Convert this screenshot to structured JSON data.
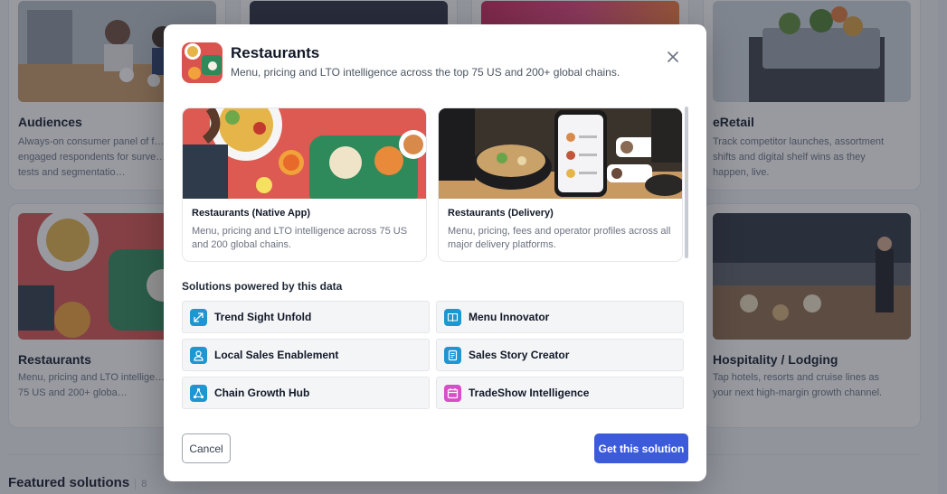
{
  "background": {
    "cards": [
      {
        "title": "Audiences",
        "description": "Always-on consumer panel of f… engaged respondents for surve… concept tests and segmentatio…"
      },
      {
        "title": "eRetail",
        "description": "Track competitor launches, assortment shifts and digital shelf wins as they happen, live."
      },
      {
        "title": "Restaurants",
        "description": "Menu, pricing and LTO intellige… the top 75 US and 200+ globa…"
      },
      {
        "title": "Hospitality / Lodging",
        "description": "Tap hotels, resorts and cruise lines as your next high-margin growth channel."
      }
    ],
    "featured": {
      "label": "Featured solutions",
      "count": "8"
    }
  },
  "modal": {
    "title": "Restaurants",
    "subtitle": "Menu, pricing and LTO intelligence across the top 75 US and 200+ global chains.",
    "close_icon": "close-icon",
    "datasets": [
      {
        "name": "Restaurants (Native App)",
        "description": "Menu, pricing and LTO intelligence across 75 US and 200 global chains."
      },
      {
        "name": "Restaurants (Delivery)",
        "description": "Menu, pricing, fees and operator profiles across all major delivery platforms."
      }
    ],
    "solutions_heading": "Solutions powered by this data",
    "solutions": [
      {
        "label": "Trend Sight Unfold",
        "icon": "expand-arrows-icon",
        "color": "#1e96d2"
      },
      {
        "label": "Menu Innovator",
        "icon": "book-icon",
        "color": "#1e96d2"
      },
      {
        "label": "Local Sales Enablement",
        "icon": "user-icon",
        "color": "#1e96d2"
      },
      {
        "label": "Sales Story Creator",
        "icon": "document-icon",
        "color": "#1e96d2"
      },
      {
        "label": "Chain Growth Hub",
        "icon": "network-icon",
        "color": "#1e96d2"
      },
      {
        "label": "TradeShow Intelligence",
        "icon": "calendar-icon",
        "color": "#d64fc8"
      }
    ],
    "cancel_label": "Cancel",
    "primary_label": "Get this solution",
    "accent_color": "#3b5bdb"
  }
}
